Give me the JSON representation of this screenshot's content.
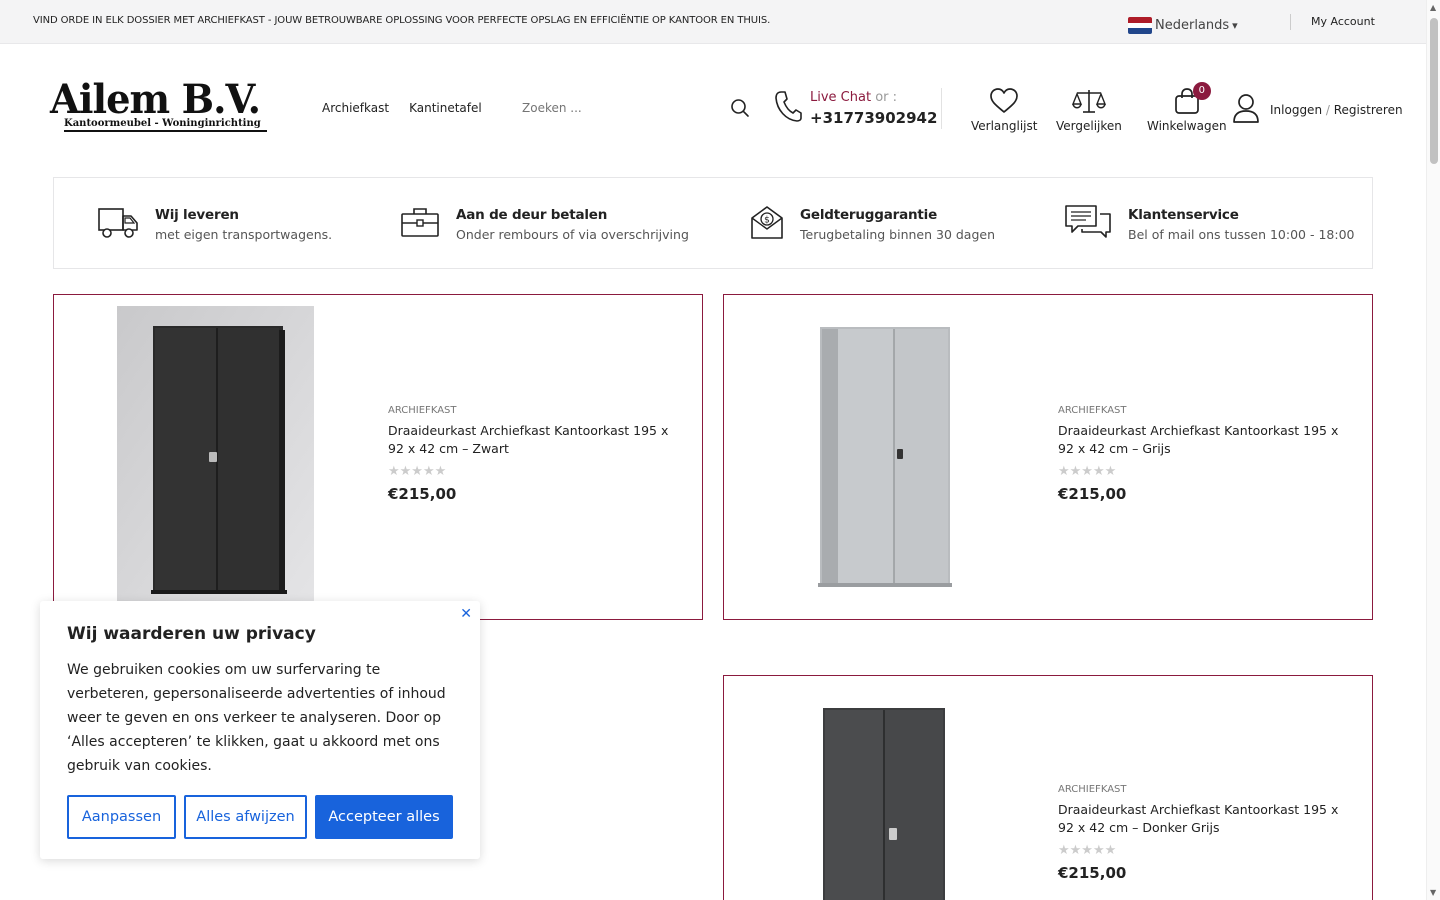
{
  "topbar": {
    "promo": "VIND ORDE IN ELK DOSSIER MET ARCHIEFKAST - JOUW BETROUWBARE OPLOSSING VOOR PERFECTE OPSLAG EN EFFICIËNTIE OP KANTOOR EN THUIS.",
    "language": "Nederlands",
    "language_caret": "▾",
    "account": "My Account"
  },
  "header": {
    "logo_title": "Ailem B.V.",
    "logo_subtitle": "Kantoormeubel - Woninginrichting",
    "nav": [
      "Archiefkast",
      "Kantinetafel"
    ],
    "search_placeholder": "Zoeken ...",
    "live_chat": "Live Chat",
    "or": "or :",
    "phone": "+31773902942",
    "wishlist": "Verlanglijst",
    "compare": "Vergelijken",
    "cart": "Winkelwagen",
    "cart_count": "0",
    "login": "Inloggen",
    "slash": "/",
    "register": "Registreren"
  },
  "features": [
    {
      "title": "Wij leveren",
      "subtitle": "met eigen transportwagens.",
      "icon": "truck-icon"
    },
    {
      "title": "Aan de deur betalen",
      "subtitle": "Onder rembours of via overschrijving",
      "icon": "briefcase-icon"
    },
    {
      "title": "Geldteruggarantie",
      "subtitle": "Terugbetaling binnen 30 dagen",
      "icon": "money-envelope-icon"
    },
    {
      "title": "Klantenservice",
      "subtitle": "Bel of mail ons tussen 10:00 - 18:00",
      "icon": "chat-bubbles-icon"
    }
  ],
  "products": [
    {
      "category": "ARCHIEFKAST",
      "title": "Draaideurkast Archiefkast Kantoorkast 195 x 92 x 42 cm – Zwart",
      "price": "€215,00",
      "stars": "★★★★★"
    },
    {
      "category": "ARCHIEFKAST",
      "title": "Draaideurkast Archiefkast Kantoorkast 195 x 92 x 42 cm – Grijs",
      "price": "€215,00",
      "stars": "★★★★★"
    },
    {
      "category": "ARCHIEFKAST",
      "title": "Draaideurkast Archiefkast Kantoorkast 195 x 92 x 42 cm – Donker Grijs",
      "price": "€215,00",
      "stars": "★★★★★"
    }
  ],
  "cookie": {
    "title": "Wij waarderen uw privacy",
    "body": "We gebruiken cookies om uw surfervaring te verbeteren, gepersonaliseerde advertenties of inhoud weer te geven en ons verkeer te analyseren. Door op ‘Alles accepteren’ te klikken, gaat u akkoord met ons gebruik van cookies.",
    "customize": "Aanpassen",
    "reject": "Alles afwijzen",
    "accept": "Accepteer alles",
    "close": "✕"
  },
  "colors": {
    "accent": "#8b1a3e",
    "cookie_blue": "#1863dc"
  }
}
